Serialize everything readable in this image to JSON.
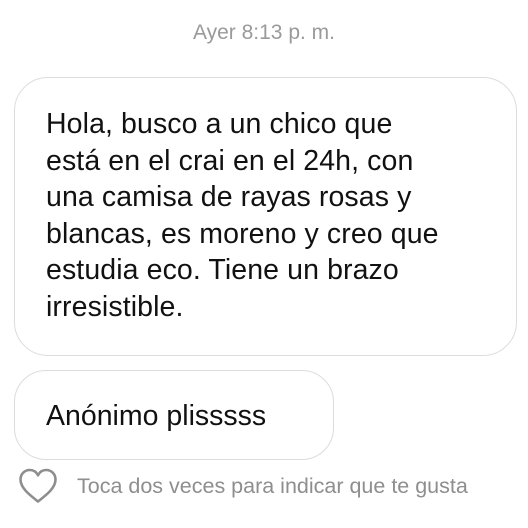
{
  "conversation": {
    "timestamp": "Ayer 8:13 p. m.",
    "messages": [
      {
        "text": "Hola, busco a un chico que\nestá en el crai en el 24h, con\nuna camisa de rayas rosas y\nblancas, es moreno y creo que\nestudia eco. Tiene un brazo\nirresistible."
      },
      {
        "text": "Anónimo plisssss"
      }
    ],
    "like_hint": "Toca dos veces para indicar que te gusta",
    "like_icon": "heart-outline-icon"
  },
  "colors": {
    "timestamp": "#9a9a9a",
    "bubble_border": "#dcdcdc",
    "message_text": "#111111",
    "hint_text": "#8e8e8e"
  }
}
